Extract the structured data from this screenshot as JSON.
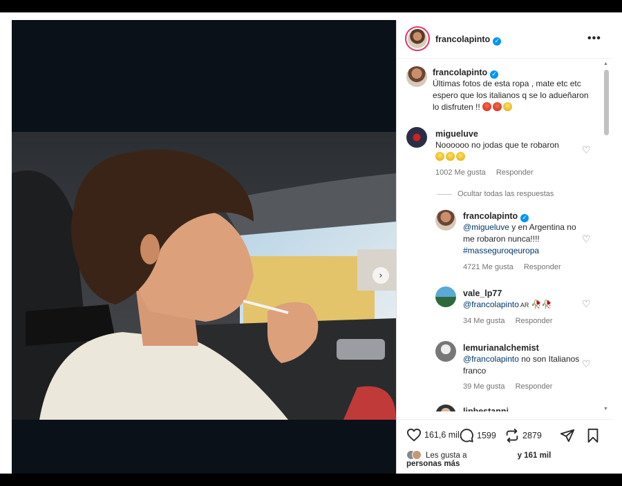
{
  "post": {
    "author": "francolapinto",
    "caption": "Últimas fotos de esta ropa , mate etc etc espero que los italianos q se lo adueñaron lo disfruten !!",
    "more_icon": "more-options-icon"
  },
  "comments": [
    {
      "user": "migueluve",
      "text": "Noooooo no jodas que te robaron",
      "likes": "1002 Me gusta",
      "reply": "Responder"
    }
  ],
  "hide_replies": "Ocultar todas las respuestas",
  "replies": [
    {
      "user": "francolapinto",
      "mention": "@migueluve",
      "text": " y en Argentina no me robaron nunca!!!!",
      "hashtag": "#masseguroqeuropa",
      "likes": "4721 Me gusta",
      "reply": "Responder"
    },
    {
      "user": "vale_lp77",
      "mention": "@francolapinto",
      "text": " AR",
      "likes": "34 Me gusta",
      "reply": "Responder"
    },
    {
      "user": "lemurianalchemist",
      "mention": "@francolapinto",
      "text": " no son Italianos franco",
      "likes": "39 Me gusta",
      "reply": "Responder"
    },
    {
      "user": "lipbestanni"
    }
  ],
  "actions": {
    "likes": "161,6 mil",
    "comments": "1599",
    "reposts": "2879",
    "liked_by_prefix": "Les gusta a",
    "liked_by_suffix": "y 161 mil",
    "liked_by_more": "personas más"
  },
  "colors": {
    "link": "#00376b",
    "verified": "#0095f6",
    "muted": "#737373"
  }
}
